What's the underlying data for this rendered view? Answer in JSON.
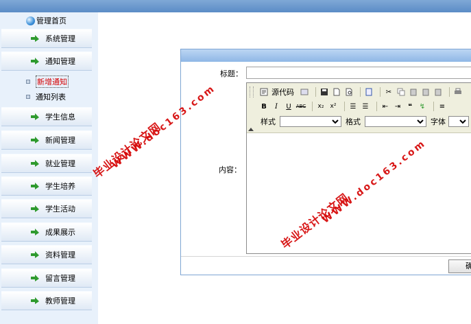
{
  "sidebar": {
    "home_label": "管理首页",
    "items": [
      {
        "label": "系统管理"
      },
      {
        "label": "通知管理"
      },
      {
        "label": "学生信息"
      },
      {
        "label": "新闻管理"
      },
      {
        "label": "就业管理"
      },
      {
        "label": "学生培养"
      },
      {
        "label": "学生活动"
      },
      {
        "label": "成果展示"
      },
      {
        "label": "资料管理"
      },
      {
        "label": "留言管理"
      },
      {
        "label": "教师管理"
      }
    ],
    "sub_items": [
      {
        "label": "新增通知",
        "active": true
      },
      {
        "label": "通知列表",
        "active": false
      }
    ]
  },
  "form": {
    "title_label": "标题：",
    "content_label": "内容：",
    "confirm_label": "确"
  },
  "editor": {
    "source_label": "源代码",
    "style_label": "样式",
    "format_label": "格式",
    "font_label": "字体"
  },
  "watermarks": {
    "name": "毕业设计论文网",
    "url": "WWW.doc163.com"
  },
  "colors": {
    "topbar": "#6b9ad0",
    "sidebar_bg": "#e8f1fb",
    "watermark": "#d40000",
    "arrow": "#2e9a2e"
  }
}
